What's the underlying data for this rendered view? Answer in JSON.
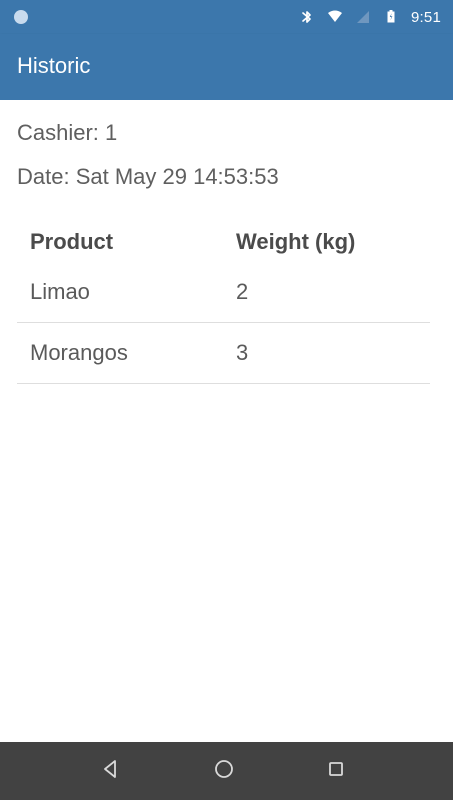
{
  "status_bar": {
    "time": "9:51",
    "icons": [
      "status-dot-icon",
      "bluetooth-icon",
      "wifi-icon",
      "signal-icon",
      "battery-icon"
    ]
  },
  "toolbar": {
    "title": "Historic"
  },
  "details": {
    "cashier": "Cashier: 1",
    "date": "Date: Sat May 29 14:53:53"
  },
  "table": {
    "headers": {
      "product": "Product",
      "weight": "Weight (kg)"
    },
    "rows": [
      {
        "product": "Limao",
        "weight": "2"
      },
      {
        "product": "Morangos",
        "weight": "3"
      }
    ]
  },
  "navigation": {
    "icons": [
      "back-icon",
      "home-icon",
      "recents-icon"
    ]
  },
  "colors": {
    "primary": "#3c77ac",
    "nav_bar": "#424242",
    "text": "#5a5a5a",
    "divider": "#dedede"
  }
}
